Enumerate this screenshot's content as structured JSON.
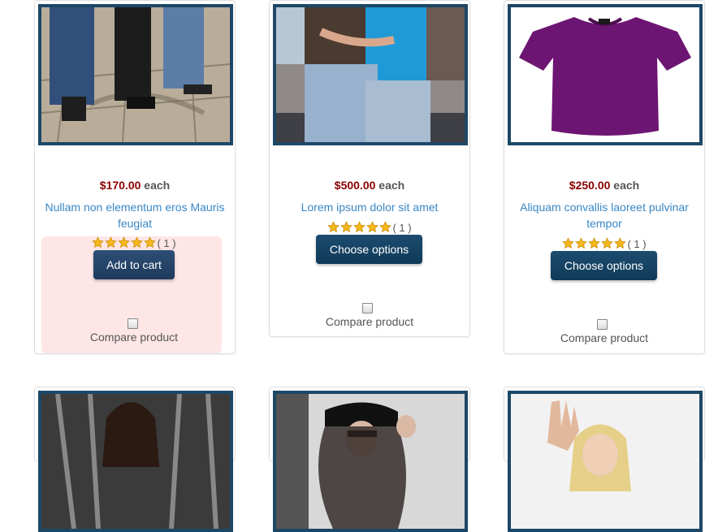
{
  "products": [
    {
      "price": "$170.00",
      "each": "each",
      "title": "Nullam non elementum eros Mauris feugiat",
      "rating": "( 1 )",
      "stars": 5,
      "button": "Add to cart",
      "compare": "Compare product"
    },
    {
      "price": "$500.00",
      "each": "each",
      "title": "Lorem ipsum dolor sit amet",
      "rating": "( 1 )",
      "stars": 5,
      "button": "Choose options",
      "compare": "Compare product"
    },
    {
      "price": "$250.00",
      "each": "each",
      "title": "Aliquam convallis laoreet pulvinar tempor",
      "rating": "( 1 )",
      "stars": 5,
      "button": "Choose options",
      "compare": "Compare product"
    }
  ],
  "colors": {
    "price": "#8b0000",
    "link": "#3a87c6",
    "image_border": "#1d4766",
    "button": "#1e3a5c"
  },
  "icons": {
    "star": "star-icon",
    "checkbox": "compare-checkbox"
  }
}
